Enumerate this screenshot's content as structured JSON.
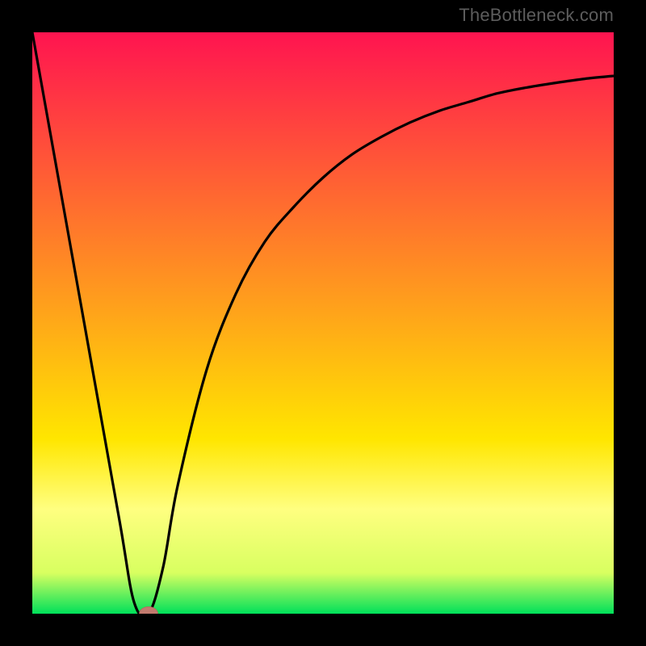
{
  "watermark": "TheBottleneck.com",
  "colors": {
    "gradient_top": "#ff1450",
    "gradient_mid1": "#ff7b2a",
    "gradient_mid2": "#ffd900",
    "gradient_mid3": "#ffff66",
    "gradient_bottom": "#00e05a",
    "line": "#000000",
    "marker_fill": "#c27a6e",
    "marker_stroke": "#b26a5f",
    "frame_bg": "#000000"
  },
  "chart_data": {
    "type": "line",
    "title": "",
    "xlabel": "",
    "ylabel": "",
    "xlim": [
      0,
      100
    ],
    "ylim": [
      0,
      100
    ],
    "grid": false,
    "legend": false,
    "series": [
      {
        "name": "curve",
        "x": [
          0,
          5,
          10,
          15,
          17.5,
          20,
          22.5,
          25,
          30,
          35,
          40,
          45,
          50,
          55,
          60,
          65,
          70,
          75,
          80,
          85,
          90,
          95,
          100
        ],
        "y": [
          100,
          72,
          44,
          16,
          2,
          0,
          8,
          22,
          42,
          55,
          64,
          70,
          75,
          79,
          82,
          84.5,
          86.5,
          88,
          89.5,
          90.5,
          91.3,
          92,
          92.5
        ]
      }
    ],
    "marker": {
      "x": 20,
      "y": 0,
      "rx": 1.6,
      "ry": 1.2
    },
    "gradient_stops": [
      {
        "offset": 0.0,
        "color": "#ff1450"
      },
      {
        "offset": 0.45,
        "color": "#ff9a1e"
      },
      {
        "offset": 0.7,
        "color": "#ffe600"
      },
      {
        "offset": 0.82,
        "color": "#ffff80"
      },
      {
        "offset": 0.93,
        "color": "#d8ff60"
      },
      {
        "offset": 1.0,
        "color": "#00e05a"
      }
    ]
  }
}
